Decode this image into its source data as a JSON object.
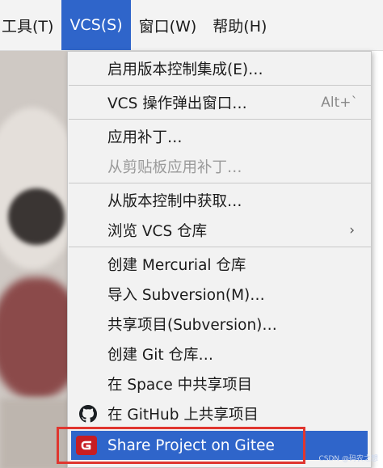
{
  "menubar": {
    "items": [
      {
        "label": "工具(T)",
        "active": false
      },
      {
        "label": "VCS(S)",
        "active": true
      },
      {
        "label": "窗口(W)",
        "active": false
      },
      {
        "label": "帮助(H)",
        "active": false
      }
    ]
  },
  "vcs_menu": {
    "enable_vcs": "启用版本控制集成(E)…",
    "vcs_popup": "VCS 操作弹出窗口…",
    "vcs_popup_shortcut": "Alt+`",
    "apply_patch": "应用补丁…",
    "apply_patch_clipboard": "从剪贴板应用补丁…",
    "get_from_vcs": "从版本控制中获取…",
    "browse_repo": "浏览 VCS 仓库",
    "create_mercurial": "创建 Mercurial 仓库",
    "import_subversion": "导入 Subversion(M)…",
    "share_subversion": "共享项目(Subversion)…",
    "create_git": "创建 Git 仓库…",
    "share_space": "在 Space 中共享项目",
    "share_github": "在 GitHub 上共享项目",
    "share_gitee": "Share Project on Gitee"
  },
  "colors": {
    "highlight": "#2f65ca",
    "annotation": "#e0362f",
    "gitee_logo": "#c71d23"
  },
  "icons": {
    "submenu": "chevron-right-icon",
    "github": "github-icon",
    "gitee": "gitee-icon"
  },
  "watermark": "CSDN @码农之想"
}
